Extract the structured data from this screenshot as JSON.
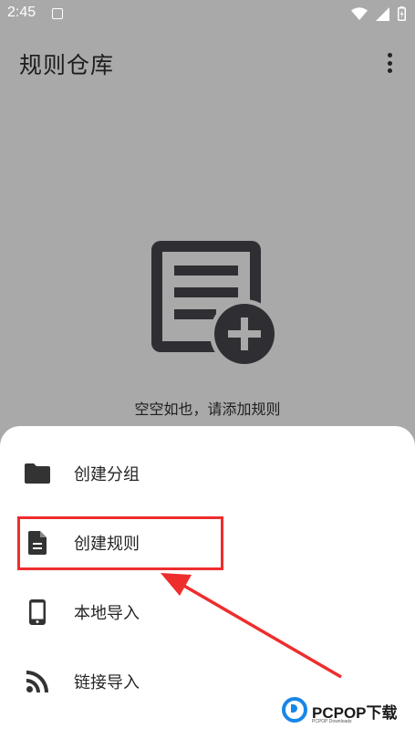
{
  "status_bar": {
    "time": "2:45"
  },
  "app_bar": {
    "title": "规则仓库"
  },
  "empty_state": {
    "message": "空空如也，请添加规则"
  },
  "sheet": {
    "items": [
      {
        "label": "创建分组",
        "icon": "folder-icon"
      },
      {
        "label": "创建规则",
        "icon": "document-icon"
      },
      {
        "label": "本地导入",
        "icon": "phone-icon"
      },
      {
        "label": "链接导入",
        "icon": "rss-icon"
      }
    ]
  },
  "watermark": {
    "brand": "PCPOP下载",
    "subtitle": "PCPOP Downloads"
  },
  "colors": {
    "scrim": "#a9a9a9",
    "sheet": "#ffffff",
    "highlight": "#ee2d2d",
    "icon": "#2f2f33",
    "watermark_blue": "#1886e8"
  }
}
